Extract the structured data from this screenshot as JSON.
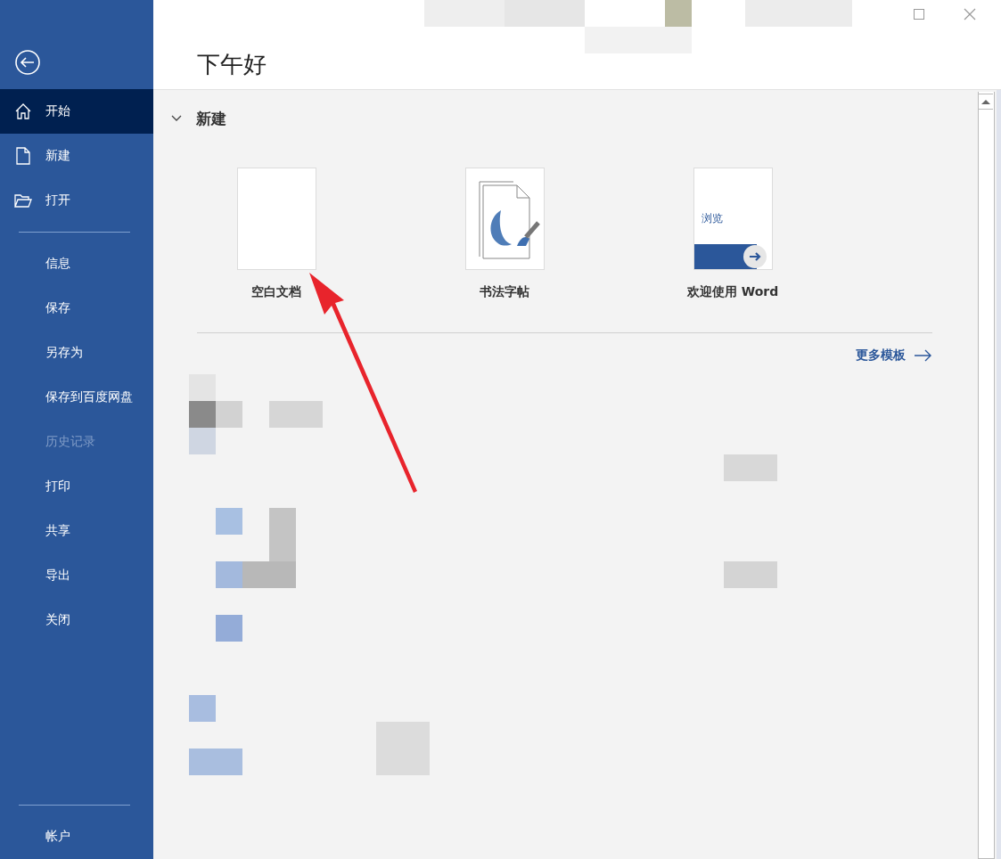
{
  "window": {
    "controls": [
      {
        "kind": "maximize"
      },
      {
        "kind": "close"
      }
    ]
  },
  "sidebar": {
    "items": [
      {
        "label": "开始",
        "kind": "home",
        "selected": true,
        "disabled": false
      },
      {
        "label": "新建",
        "kind": "file",
        "selected": false,
        "disabled": false
      },
      {
        "label": "打开",
        "kind": "folder",
        "selected": false,
        "disabled": false
      },
      {
        "kind": "divider"
      },
      {
        "label": "信息",
        "kind": "plain",
        "selected": false,
        "disabled": false
      },
      {
        "label": "保存",
        "kind": "plain",
        "selected": false,
        "disabled": false
      },
      {
        "label": "另存为",
        "kind": "plain",
        "selected": false,
        "disabled": false
      },
      {
        "label": "保存到百度网盘",
        "kind": "plain",
        "selected": false,
        "disabled": false
      },
      {
        "label": "历史记录",
        "kind": "plain",
        "selected": false,
        "disabled": true
      },
      {
        "label": "打印",
        "kind": "plain",
        "selected": false,
        "disabled": false
      },
      {
        "label": "共享",
        "kind": "plain",
        "selected": false,
        "disabled": false
      },
      {
        "label": "导出",
        "kind": "plain",
        "selected": false,
        "disabled": false
      },
      {
        "label": "关闭",
        "kind": "plain",
        "selected": false,
        "disabled": false
      }
    ],
    "footer": [
      {
        "label": "帐户",
        "selected": false
      }
    ]
  },
  "greeting": "下午好",
  "new_section": {
    "title": "新建",
    "expanded": true,
    "templates": [
      {
        "kind": "blank",
        "label": "空白文档"
      },
      {
        "kind": "calligraphy",
        "label": "书法字帖"
      },
      {
        "kind": "tour",
        "label": "欢迎使用 Word",
        "thumb_text": "浏览"
      }
    ],
    "more_link": "更多模板"
  }
}
